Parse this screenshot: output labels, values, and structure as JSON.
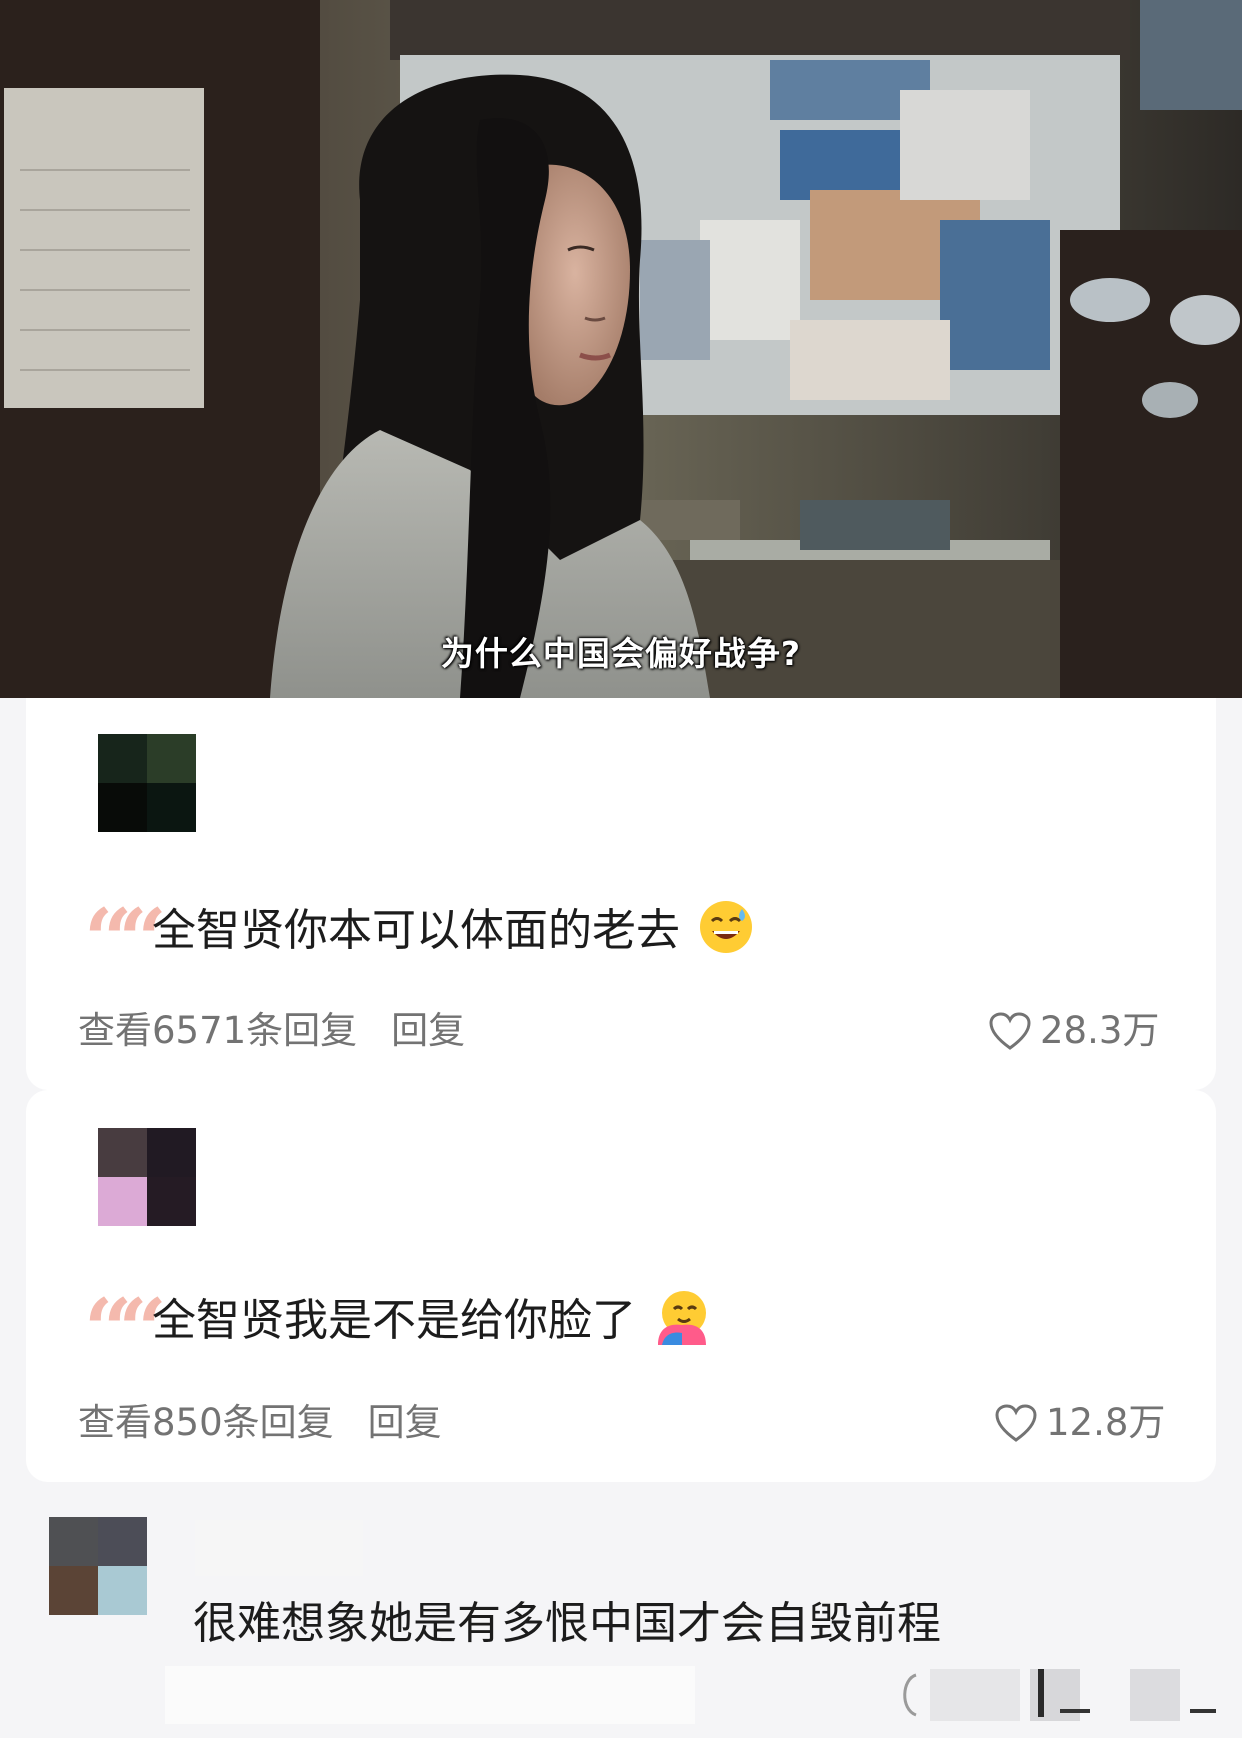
{
  "video": {
    "subtitle": "为什么中国会偏好战争?"
  },
  "comments": [
    {
      "avatar_colors": [
        "#17251b",
        "#2b3d28",
        "#080b08",
        "#0b1611"
      ],
      "quote_glyph": "66",
      "text": "全智贤你本可以体面的老去",
      "emoji": "grinning-sweat-face-icon",
      "view_replies": "查看6571条回复",
      "reply_label": "回复",
      "likes": "28.3万"
    },
    {
      "avatar_colors": [
        "#483c40",
        "#211a23",
        "#dcaad6",
        "#251b24"
      ],
      "quote_glyph": "66",
      "text": "全智贤我是不是给你脸了",
      "emoji": "hugging-face-icon",
      "view_replies": "查看850条回复",
      "reply_label": "回复",
      "likes": "12.8万"
    }
  ],
  "bottom_comment": {
    "avatar_colors": [
      "#4f5053",
      "#4c4d57",
      "#5b4436",
      "#a9c9d3"
    ],
    "text": "很难想象她是有多恨中国才会自毁前程"
  },
  "colors": {
    "quote": "#f4b9ad",
    "meta_text": "#737373",
    "comment_text": "#1c1c1c"
  }
}
